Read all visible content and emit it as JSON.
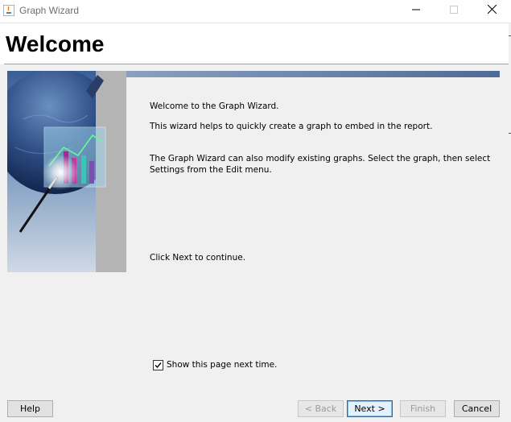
{
  "window": {
    "title": "Graph Wizard",
    "minimize": "—",
    "maximize": "☐",
    "close": "✕"
  },
  "header": {
    "heading": "Welcome"
  },
  "content": {
    "line1": "Welcome to the Graph Wizard.",
    "line2": "This wizard helps to quickly create a graph to embed in the report.",
    "line3": "The Graph Wizard can also modify existing graphs. Select the graph, then select\nSettings from the Edit menu.",
    "line4": "Click Next to continue."
  },
  "options": {
    "show_page_label": "Show this page next time.",
    "show_page_checked": true
  },
  "buttons": {
    "help": "Help",
    "back": "< Back",
    "next": "Next >",
    "finish": "Finish",
    "cancel": "Cancel"
  },
  "colors": {
    "accent": "#0078d7",
    "stripe": "#4f6a94"
  }
}
